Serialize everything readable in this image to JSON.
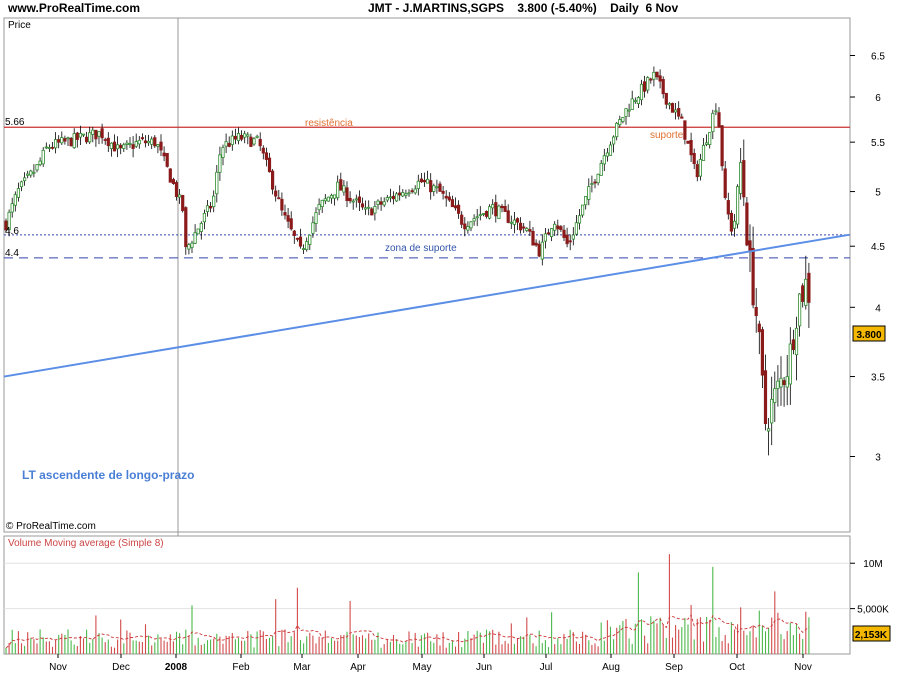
{
  "header": {
    "site": "www.ProRealTime.com",
    "instrument": "JMT - J.MARTINS,SGPS",
    "price_change": "3.800 (-5.40%)",
    "period": "Daily",
    "date": "6 Nov"
  },
  "price_panel": {
    "label": "Price",
    "copyright": "© ProRealTime.com",
    "current_price_label": "3.800",
    "resistance_value_label": "5.66",
    "resistance_text": "resistência",
    "support_text": "suporte",
    "upper_support_value_label": "4.6",
    "lower_support_value_label": "4.4",
    "support_zone_text": "zona de suporte",
    "trendline_text": "LT ascendente de longo-prazo"
  },
  "volume_panel": {
    "label": "Volume Moving average (Simple 8)",
    "current_volume_label": "2,153K"
  },
  "colors": {
    "up": "#2e8b2e",
    "down": "#8b1a1a",
    "resistance": "#cc3333",
    "annotation": "#e07030",
    "support": "#3344aa",
    "trendline": "#5b8ee6",
    "price_box": "#f5b800",
    "panel_bg": "#ffffff"
  },
  "chart_data": {
    "type": "candlestick",
    "title": "JMT - J.MARTINS,SGPS",
    "scale": "log",
    "x_tick_labels": [
      "Nov",
      "Dec",
      "2008",
      "Feb",
      "Mar",
      "Apr",
      "May",
      "Jun",
      "Jul",
      "Aug",
      "Sep",
      "Oct",
      "Nov"
    ],
    "y_tick_labels": [
      "6.5",
      "6",
      "5.5",
      "5",
      "4.5",
      "4",
      "3.5",
      "3"
    ],
    "y_ticks": [
      6.5,
      6,
      5.5,
      5,
      4.5,
      4,
      3.5,
      3
    ],
    "ylim": [
      2.65,
      6.95
    ],
    "last_price": 3.8,
    "levels": {
      "resistance": 5.66,
      "support_upper": 4.6,
      "support_lower": 4.4
    },
    "trendline": {
      "start": {
        "month": "Oct 2007",
        "price": 3.5
      },
      "end": {
        "month": "Nov 2008",
        "price": 4.6
      }
    },
    "close_path": [
      {
        "month": "Oct 2007",
        "price": 4.7
      },
      {
        "month": "Oct 2007",
        "price": 5.0
      },
      {
        "month": "Nov",
        "price": 5.25
      },
      {
        "month": "Nov",
        "price": 5.45
      },
      {
        "month": "Dec",
        "price": 5.6
      },
      {
        "month": "Dec",
        "price": 5.4
      },
      {
        "month": "Dec",
        "price": 5.5
      },
      {
        "month": "2008",
        "price": 5.5
      },
      {
        "month": "2008",
        "price": 4.8
      },
      {
        "month": "Jan",
        "price": 4.45
      },
      {
        "month": "Jan",
        "price": 4.9
      },
      {
        "month": "Feb",
        "price": 5.45
      },
      {
        "month": "Feb",
        "price": 5.55
      },
      {
        "month": "Feb",
        "price": 5.5
      },
      {
        "month": "Mar",
        "price": 4.8
      },
      {
        "month": "Mar",
        "price": 4.45
      },
      {
        "month": "Mar",
        "price": 4.85
      },
      {
        "month": "Apr",
        "price": 5.05
      },
      {
        "month": "Apr",
        "price": 4.8
      },
      {
        "month": "May",
        "price": 5.0
      },
      {
        "month": "May",
        "price": 5.1
      },
      {
        "month": "May",
        "price": 5.0
      },
      {
        "month": "Jun",
        "price": 4.7
      },
      {
        "month": "Jun",
        "price": 4.85
      },
      {
        "month": "Jul",
        "price": 4.65
      },
      {
        "month": "Jul",
        "price": 4.45
      },
      {
        "month": "Jul",
        "price": 4.75
      },
      {
        "month": "Jul",
        "price": 4.5
      },
      {
        "month": "Aug",
        "price": 5.05
      },
      {
        "month": "Aug",
        "price": 5.5
      },
      {
        "month": "Aug",
        "price": 5.9
      },
      {
        "month": "Sep",
        "price": 6.25
      },
      {
        "month": "Sep",
        "price": 5.95
      },
      {
        "month": "Sep",
        "price": 5.7
      },
      {
        "month": "Sep",
        "price": 5.15
      },
      {
        "month": "Oct",
        "price": 5.95
      },
      {
        "month": "Oct",
        "price": 4.9
      },
      {
        "month": "Oct",
        "price": 4.6
      },
      {
        "month": "Oct",
        "price": 5.3
      },
      {
        "month": "Oct",
        "price": 4.4
      },
      {
        "month": "Oct",
        "price": 3.9
      },
      {
        "month": "Oct",
        "price": 3.2
      },
      {
        "month": "Nov",
        "price": 3.6
      },
      {
        "month": "Nov",
        "price": 4.05
      },
      {
        "month": "Nov",
        "price": 4.2
      },
      {
        "month": "Nov",
        "price": 3.8
      }
    ],
    "volume": {
      "y_tick_labels": [
        "10M",
        "5,000K"
      ],
      "y_ticks": [
        10000000,
        5000000
      ],
      "ylim": [
        0,
        13000000
      ],
      "last": 2153000
    }
  }
}
